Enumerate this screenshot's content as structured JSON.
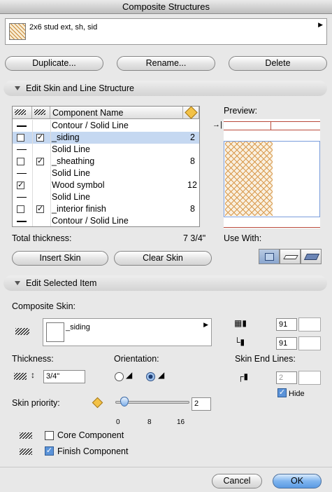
{
  "window": {
    "title": "Composite Structures"
  },
  "composite_selector": {
    "name": "2x6 stud ext, sh, sid"
  },
  "top_buttons": {
    "duplicate": "Duplicate...",
    "rename": "Rename...",
    "delete": "Delete"
  },
  "edit_skin": {
    "header": "Edit Skin and Line Structure",
    "columns": {
      "name": "Component Name"
    },
    "rows": [
      {
        "line": "Contour /  Solid Line",
        "bold": true
      },
      {
        "name": "_siding",
        "thickness": "2",
        "core": false,
        "finish": true,
        "selected": true
      },
      {
        "line": "Solid Line"
      },
      {
        "name": "_sheathing",
        "thickness": "8",
        "core": false,
        "finish": true
      },
      {
        "line": "Solid Line"
      },
      {
        "name": "Wood symbol",
        "thickness": "12",
        "core": true
      },
      {
        "line": "Solid Line"
      },
      {
        "name": "_interior finish",
        "thickness": "8",
        "core": false,
        "finish": true
      },
      {
        "line": "Contour /  Solid Line",
        "bold": true
      }
    ],
    "total_label": "Total thickness:",
    "total_value": "7 3/4\"",
    "preview_label": "Preview:",
    "use_with_label": "Use With:",
    "insert_skin": "Insert Skin",
    "clear_skin": "Clear Skin"
  },
  "edit_selected": {
    "header": "Edit Selected Item",
    "composite_skin_label": "Composite Skin:",
    "fill_name": "_siding",
    "pen_1": "91",
    "pen_2": "91",
    "thickness_label": "Thickness:",
    "thickness_value": "3/4\"",
    "orientation_label": "Orientation:",
    "skin_end_lines_label": "Skin End Lines:",
    "end_line_pen": "2",
    "hide_label": "Hide",
    "hide_checked": true,
    "priority_label": "Skin priority:",
    "priority_value": "2",
    "slider_ticks": [
      "0",
      "8",
      "16"
    ],
    "core_component_label": "Core Component",
    "core_component_checked": false,
    "finish_component_label": "Finish Component",
    "finish_component_checked": true
  },
  "footer": {
    "cancel": "Cancel",
    "ok": "OK"
  }
}
